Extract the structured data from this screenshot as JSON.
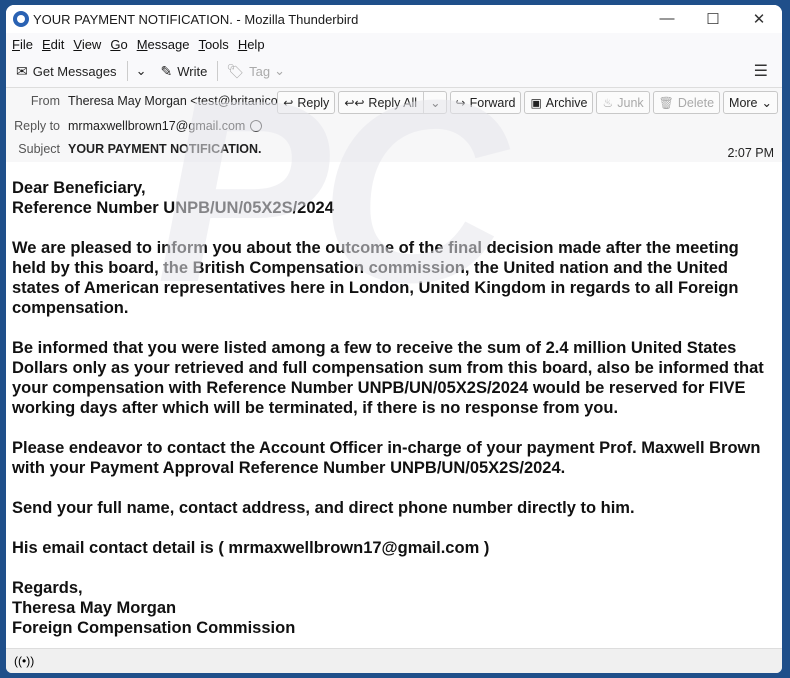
{
  "window": {
    "title": "YOUR PAYMENT NOTIFICATION. - Mozilla Thunderbird",
    "minimize": "—",
    "maximize": "☐",
    "close": "✕"
  },
  "menu": [
    {
      "label": "File",
      "key": "F",
      "rest": "ile"
    },
    {
      "label": "Edit",
      "key": "E",
      "rest": "dit"
    },
    {
      "label": "View",
      "key": "V",
      "rest": "iew"
    },
    {
      "label": "Go",
      "key": "G",
      "rest": "o"
    },
    {
      "label": "Message",
      "key": "M",
      "rest": "essage"
    },
    {
      "label": "Tools",
      "key": "T",
      "rest": "ools"
    },
    {
      "label": "Help",
      "key": "H",
      "rest": "elp"
    }
  ],
  "toolbar": {
    "get_messages": "Get Messages",
    "write": "Write",
    "tag": "Tag",
    "menu_icon": "☰"
  },
  "header": {
    "from_label": "From",
    "from_value": "Theresa May Morgan <test@britanico.cl>",
    "replyto_label": "Reply to",
    "replyto_value": "mrmaxwellbrown17@gmail.com",
    "subject_label": "Subject",
    "subject_value": "YOUR PAYMENT NOTIFICATION.",
    "time": "2:07 PM",
    "buttons": {
      "reply": "Reply",
      "reply_all": "Reply All",
      "forward": "Forward",
      "archive": "Archive",
      "junk": "Junk",
      "delete": "Delete",
      "more": "More"
    }
  },
  "body": {
    "greeting": [
      "Dear Beneficiary,",
      "Reference Number UNPB/UN/05X2S/2024"
    ],
    "p1": "We are pleased to inform you about the outcome of the final decision made after the meeting held by this board, the British Compensation commission, the United nation and the United states of American representatives here in London, United Kingdom in regards to all Foreign compensation.",
    "p2": "Be informed that you were listed among a few to receive the sum of 2.4 million United States Dollars only as your retrieved and full compensation sum from this board, also be informed that your compensation with Reference Number UNPB/UN/05X2S/2024 would be reserved for FIVE working days after which will be terminated, if there is no response from you.",
    "p3": "Please endeavor to contact the Account Officer in-charge of your payment Prof. Maxwell Brown with your Payment Approval Reference Number UNPB/UN/05X2S/2024.",
    "p4": "Send your full name, contact address, and direct phone number directly to him.",
    "p5": "His email contact detail is ( mrmaxwellbrown17@gmail.com )",
    "signoff": [
      "Regards,",
      "Theresa May Morgan",
      "Foreign Compensation Commission"
    ]
  },
  "status": {
    "icon": "((•))"
  }
}
